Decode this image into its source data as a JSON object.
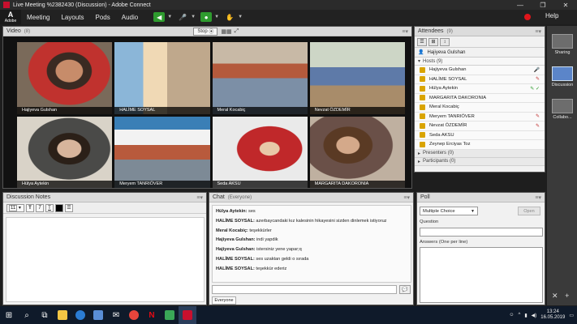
{
  "window": {
    "title": "Live Meeting %2382430 (Discussion) - Adobe Connect",
    "logo_letter": "A",
    "logo_text": "Adobe"
  },
  "menu": {
    "items": [
      "Meeting",
      "Layouts",
      "Pods",
      "Audio"
    ],
    "help": "Help"
  },
  "video": {
    "title": "Video",
    "count": "(8)",
    "stop_label": "Stop",
    "tiles": [
      "Hajiyeva Gulshan",
      "HALİME SOYSAL",
      "Meral Kocabiç",
      "Nevzat ÖZDEMİR",
      "Hülya Aytekin",
      "Meryem TANRIÖVER",
      "Seda AKSU",
      "MARGARITA DAKORONIA"
    ]
  },
  "attendees": {
    "title": "Attendees",
    "count": "(9)",
    "me": "Hajiyeva Gulshan",
    "hosts_label": "Hosts (9)",
    "hosts": [
      {
        "name": "Hajiyeva Gulshan",
        "status": "🎤"
      },
      {
        "name": "HALİME SOYSAL",
        "status": "✎"
      },
      {
        "name": "Hülya Aytekin",
        "status": "✎ ✓"
      },
      {
        "name": "MARGARITA DAKORONIA",
        "status": ""
      },
      {
        "name": "Meral Kocabiç",
        "status": ""
      },
      {
        "name": "Meryem TANRIÖVER",
        "status": "✎"
      },
      {
        "name": "Nevzat ÖZDEMİR",
        "status": "✎"
      },
      {
        "name": "Seda AKSU",
        "status": ""
      },
      {
        "name": "Zeynep Erciyas Toz",
        "status": ""
      }
    ],
    "presenters_label": "Presenters (0)",
    "participants_label": "Participants (0)"
  },
  "sidebar": {
    "items": [
      "Sharing",
      "Discussion",
      "Collabo..."
    ]
  },
  "notes": {
    "title": "Discussion Notes",
    "font_size": "11"
  },
  "chat": {
    "title": "Chat",
    "scope": "(Everyone)",
    "tab": "Everyone",
    "messages": [
      {
        "sender": "Hülya Aytekin:",
        "text": "ses"
      },
      {
        "sender": "HALİME SOYSAL:",
        "text": "azerbaycandaki kız kalesinin hikayesini sizden dinlemek istiyoruz"
      },
      {
        "sender": "Meral Kocabiç:",
        "text": "teşekkürler"
      },
      {
        "sender": "Hajiyeva Gulshan:",
        "text": "indi yapdik"
      },
      {
        "sender": "Hajiyeva Gulshan:",
        "text": "istersiniz yene yapar;q"
      },
      {
        "sender": "HALİME SOYSAL:",
        "text": "ses uzaktan geldi o sırada"
      },
      {
        "sender": "HALİME SOYSAL:",
        "text": "teşekkür ederiz"
      }
    ]
  },
  "poll": {
    "title": "Poll",
    "type": "Multiple Choice",
    "open_label": "Open",
    "question_label": "Question",
    "answers_label": "Answers (One per line)"
  },
  "taskbar": {
    "time": "13:24",
    "date": "16.05.2019"
  }
}
